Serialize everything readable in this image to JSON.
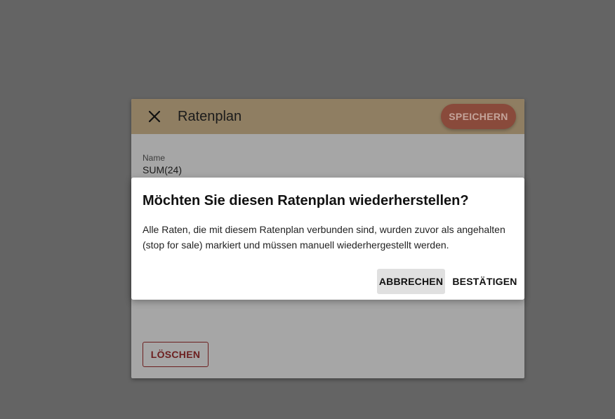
{
  "edit_dialog": {
    "title": "Ratenplan",
    "close_icon": "close-icon",
    "save_label": "SPEICHERN",
    "name_label": "Name",
    "name_value": "SUM(24)",
    "delete_label": "LÖSCHEN"
  },
  "confirm_dialog": {
    "title": "Möchten Sie diesen Ratenplan wiederherstellen?",
    "message": "Alle Raten, die mit diesem Ratenplan verbunden sind, wurden zuvor als angehalten (stop for sale) markiert und müssen manuell wiederhergestellt werden.",
    "cancel_label": "ABBRECHEN",
    "confirm_label": "BESTÄTIGEN"
  },
  "colors": {
    "header": "#8f7e62",
    "save_button": "#894a3b",
    "delete_text": "#6c1f1f",
    "backdrop": "#646464"
  }
}
